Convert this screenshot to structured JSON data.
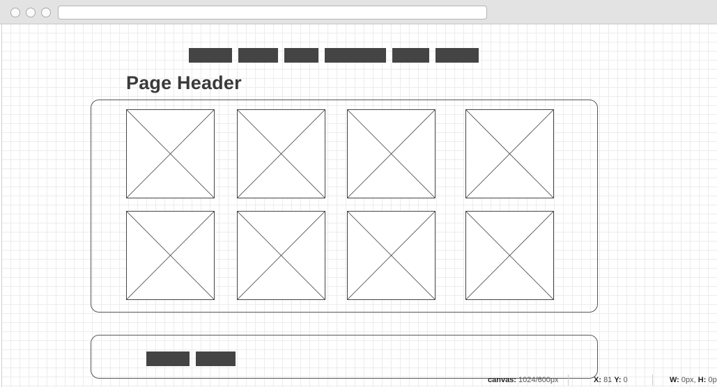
{
  "page": {
    "header": "Page Header"
  },
  "nav": {
    "items": [
      "",
      "",
      "",
      "",
      "",
      ""
    ]
  },
  "gallery": {
    "rows": 2,
    "columns": 4,
    "thumbnail_icon": "image-placeholder-icon"
  },
  "footer": {
    "buttons": [
      "",
      ""
    ]
  },
  "status": {
    "canvas_label": "canvas:",
    "canvas_value": "1024/600px",
    "x_label": "X:",
    "x_value": "81",
    "y_label": "Y:",
    "y_value": "0",
    "w_label": "W:",
    "w_value": "0px,",
    "h_label": "H:",
    "h_value": "0p"
  },
  "colors": {
    "block": "#444444",
    "grid": "#ececec",
    "border": "#555555"
  }
}
